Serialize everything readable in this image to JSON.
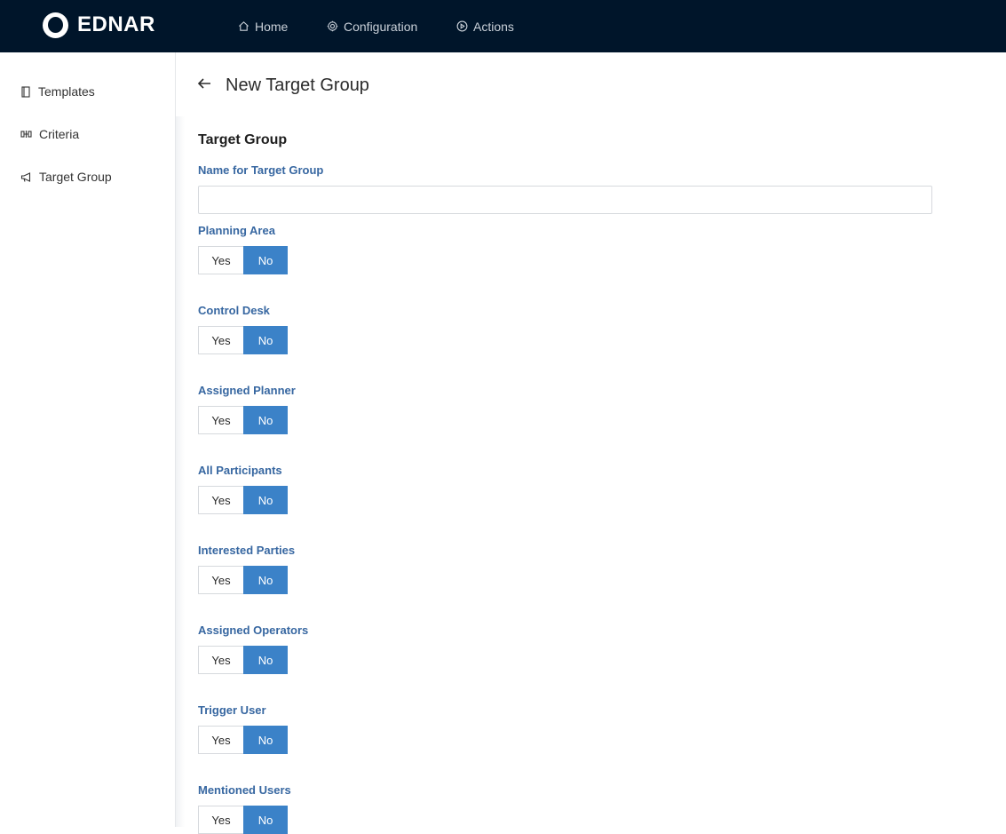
{
  "app": {
    "brand": "EDNAR"
  },
  "nav": {
    "home": {
      "label": "Home",
      "icon": "home-icon"
    },
    "configuration": {
      "label": "Configuration",
      "icon": "gear-icon"
    },
    "actions": {
      "label": "Actions",
      "icon": "play-circle-icon"
    }
  },
  "sidebar": {
    "items": [
      {
        "label": "Templates",
        "icon": "book-icon"
      },
      {
        "label": "Criteria",
        "icon": "criteria-icon"
      },
      {
        "label": "Target Group",
        "icon": "megaphone-icon"
      }
    ]
  },
  "page": {
    "title": "New Target Group",
    "section_title": "Target Group",
    "name_label": "Name for Target Group",
    "name_value": "",
    "name_placeholder": ""
  },
  "toggles": [
    {
      "label": "Planning Area",
      "yes": "Yes",
      "no": "No",
      "selected": "No"
    },
    {
      "label": "Control Desk",
      "yes": "Yes",
      "no": "No",
      "selected": "No"
    },
    {
      "label": "Assigned Planner",
      "yes": "Yes",
      "no": "No",
      "selected": "No"
    },
    {
      "label": "All Participants",
      "yes": "Yes",
      "no": "No",
      "selected": "No"
    },
    {
      "label": "Interested Parties",
      "yes": "Yes",
      "no": "No",
      "selected": "No"
    },
    {
      "label": "Assigned Operators",
      "yes": "Yes",
      "no": "No",
      "selected": "No"
    },
    {
      "label": "Trigger User",
      "yes": "Yes",
      "no": "No",
      "selected": "No"
    },
    {
      "label": "Mentioned Users",
      "yes": "Yes",
      "no": "No",
      "selected": "No"
    }
  ],
  "colors": {
    "topbar": "#00152a",
    "label": "#3767a1",
    "active_toggle": "#3b82c8"
  }
}
